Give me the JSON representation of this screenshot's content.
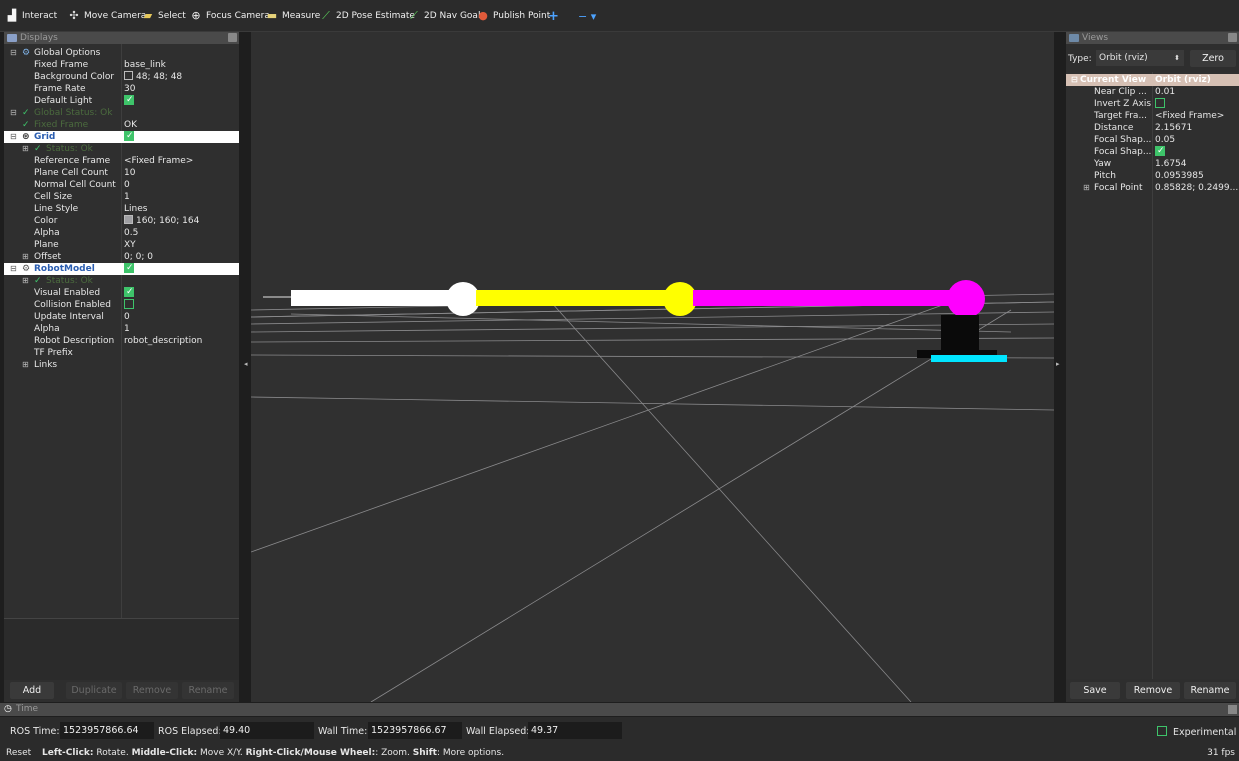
{
  "toolbar": {
    "tools": [
      {
        "label": "Interact",
        "icon": "hand-icon"
      },
      {
        "label": "Move Camera",
        "icon": "move-camera-icon"
      },
      {
        "label": "Select",
        "icon": "select-icon"
      },
      {
        "label": "Focus Camera",
        "icon": "focus-camera-icon"
      },
      {
        "label": "Measure",
        "icon": "measure-icon"
      },
      {
        "label": "2D Pose Estimate",
        "icon": "pose-estimate-icon"
      },
      {
        "label": "2D Nav Goal",
        "icon": "nav-goal-icon"
      },
      {
        "label": "Publish Point",
        "icon": "publish-point-icon"
      }
    ],
    "add_symbol": "+",
    "remove_symbol": "− ▾"
  },
  "displays": {
    "title": "Displays",
    "rows": [
      {
        "key": "Global Options",
        "value": ""
      },
      {
        "key": "Fixed Frame",
        "value": "base_link"
      },
      {
        "key": "Background Color",
        "value": "48; 48; 48"
      },
      {
        "key": "Frame Rate",
        "value": "30"
      },
      {
        "key": "Default Light",
        "value": ""
      },
      {
        "key": "Global Status: Ok",
        "value": ""
      },
      {
        "key": "Fixed Frame",
        "value": "OK"
      },
      {
        "key": "Grid",
        "value": ""
      },
      {
        "key": "Status: Ok",
        "value": ""
      },
      {
        "key": "Reference Frame",
        "value": "<Fixed Frame>"
      },
      {
        "key": "Plane Cell Count",
        "value": "10"
      },
      {
        "key": "Normal Cell Count",
        "value": "0"
      },
      {
        "key": "Cell Size",
        "value": "1"
      },
      {
        "key": "Line Style",
        "value": "Lines"
      },
      {
        "key": "Color",
        "value": "160; 160; 164"
      },
      {
        "key": "Alpha",
        "value": "0.5"
      },
      {
        "key": "Plane",
        "value": "XY"
      },
      {
        "key": "Offset",
        "value": "0; 0; 0"
      },
      {
        "key": "RobotModel",
        "value": ""
      },
      {
        "key": "Status: Ok",
        "value": ""
      },
      {
        "key": "Visual Enabled",
        "value": ""
      },
      {
        "key": "Collision Enabled",
        "value": ""
      },
      {
        "key": "Update Interval",
        "value": "0"
      },
      {
        "key": "Alpha",
        "value": "1"
      },
      {
        "key": "Robot Description",
        "value": "robot_description"
      },
      {
        "key": "TF Prefix",
        "value": ""
      },
      {
        "key": "Links",
        "value": ""
      }
    ],
    "buttons": {
      "add": "Add",
      "duplicate": "Duplicate",
      "remove": "Remove",
      "rename": "Rename"
    }
  },
  "colors": {
    "background": "#303030",
    "grid": "#a0a0a4",
    "link_white": "#ffffff",
    "link_yellow": "#ffff00",
    "link_magenta": "#ff00ff",
    "base_cyan": "#00e5ff",
    "checkbox": "#3ec46a"
  },
  "views": {
    "title": "Views",
    "type_label": "Type:",
    "type_value": "Orbit (rviz)",
    "zero_button": "Zero",
    "rows": [
      {
        "key": "Current View",
        "value": "Orbit (rviz)"
      },
      {
        "key": "Near Clip ...",
        "value": "0.01"
      },
      {
        "key": "Invert Z Axis",
        "value": ""
      },
      {
        "key": "Target Fra...",
        "value": "<Fixed Frame>"
      },
      {
        "key": "Distance",
        "value": "2.15671"
      },
      {
        "key": "Focal Shap...",
        "value": "0.05"
      },
      {
        "key": "Focal Shap...",
        "value": ""
      },
      {
        "key": "Yaw",
        "value": "1.6754"
      },
      {
        "key": "Pitch",
        "value": "0.0953985"
      },
      {
        "key": "Focal Point",
        "value": "0.85828; 0.2499..."
      }
    ],
    "buttons": {
      "save": "Save",
      "remove": "Remove",
      "rename": "Rename"
    }
  },
  "time": {
    "title": "Time",
    "ros_time_label": "ROS Time:",
    "ros_time": "1523957866.64",
    "ros_elapsed_label": "ROS Elapsed:",
    "ros_elapsed": "49.40",
    "wall_time_label": "Wall Time:",
    "wall_time": "1523957866.67",
    "wall_elapsed_label": "Wall Elapsed:",
    "wall_elapsed": "49.37",
    "experimental": "Experimental"
  },
  "status": {
    "reset": "Reset",
    "hint_1_bold": "Left-Click:",
    "hint_1": " Rotate. ",
    "hint_2_bold": "Middle-Click:",
    "hint_2": " Move X/Y. ",
    "hint_3_bold": "Right-Click/Mouse Wheel:",
    "hint_3": ": Zoom. ",
    "hint_4_bold": "Shift",
    "hint_4": ": More options.",
    "fps": "31 fps"
  }
}
